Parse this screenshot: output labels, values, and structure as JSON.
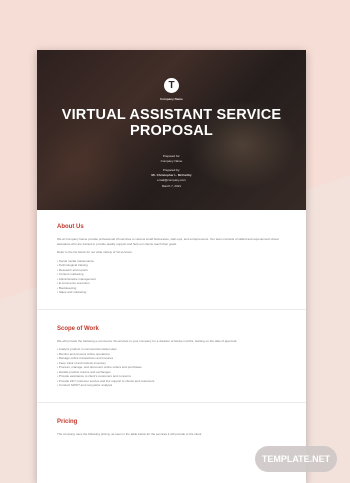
{
  "document": {
    "logo_letter": "T",
    "company_name": "Company Name",
    "title_line1": "VIRTUAL ASSISTANT SERVICE",
    "title_line2": "PROPOSAL",
    "prepared_for_label": "Prepared for:",
    "prepared_for_name": "Company Name",
    "prepared_by_label": "Prepared by:",
    "prepared_by_name": "Mr. Christopher L. McCarthy",
    "prepared_by_email": "email@company.com",
    "date": "March 7, 2021"
  },
  "sections": [
    {
      "heading": "About Us",
      "paragraphs": [
        "We at Company Name provide professional VA services to various small businesses, start-ups, and entrepreneurs. Our team consists of skilled and experienced virtual assistants who are trained to provide quality support and help our clients reach their goals.",
        "Refer to the list below for our wide variety of VA services:"
      ],
      "bullets": [
        "Social media maintenance",
        "Technological training",
        "Research and reports",
        "Content marketing",
        "Administrative management",
        "E-commerce execution",
        "Bookkeeping",
        "Sales and marketing"
      ]
    },
    {
      "heading": "Scope of Work",
      "paragraphs": [
        "We will provide the following e-commerce VA services to your company for a duration of twelve months, starting on the date of approval."
      ],
      "bullets": [
        "Analyze product in commercial market sites",
        "Monitor and process online operations",
        "Manage online transactions and invoices",
        "Keep track of and restock inventory",
        "Process, manage, and document online orders and purchases",
        "Handle product returns and exchanges",
        "Provide assistance to client's customers and concerns",
        "Provide 24/7 customer service and live support to clients and customers",
        "Conduct SWOT and competitor analysis"
      ]
    },
    {
      "heading": "Pricing",
      "paragraphs": [
        "The company uses the following pricing, as seen in the table below for the services it will provide to the client."
      ],
      "bullets": []
    }
  ],
  "watermark": "TEMPLATE.NET"
}
